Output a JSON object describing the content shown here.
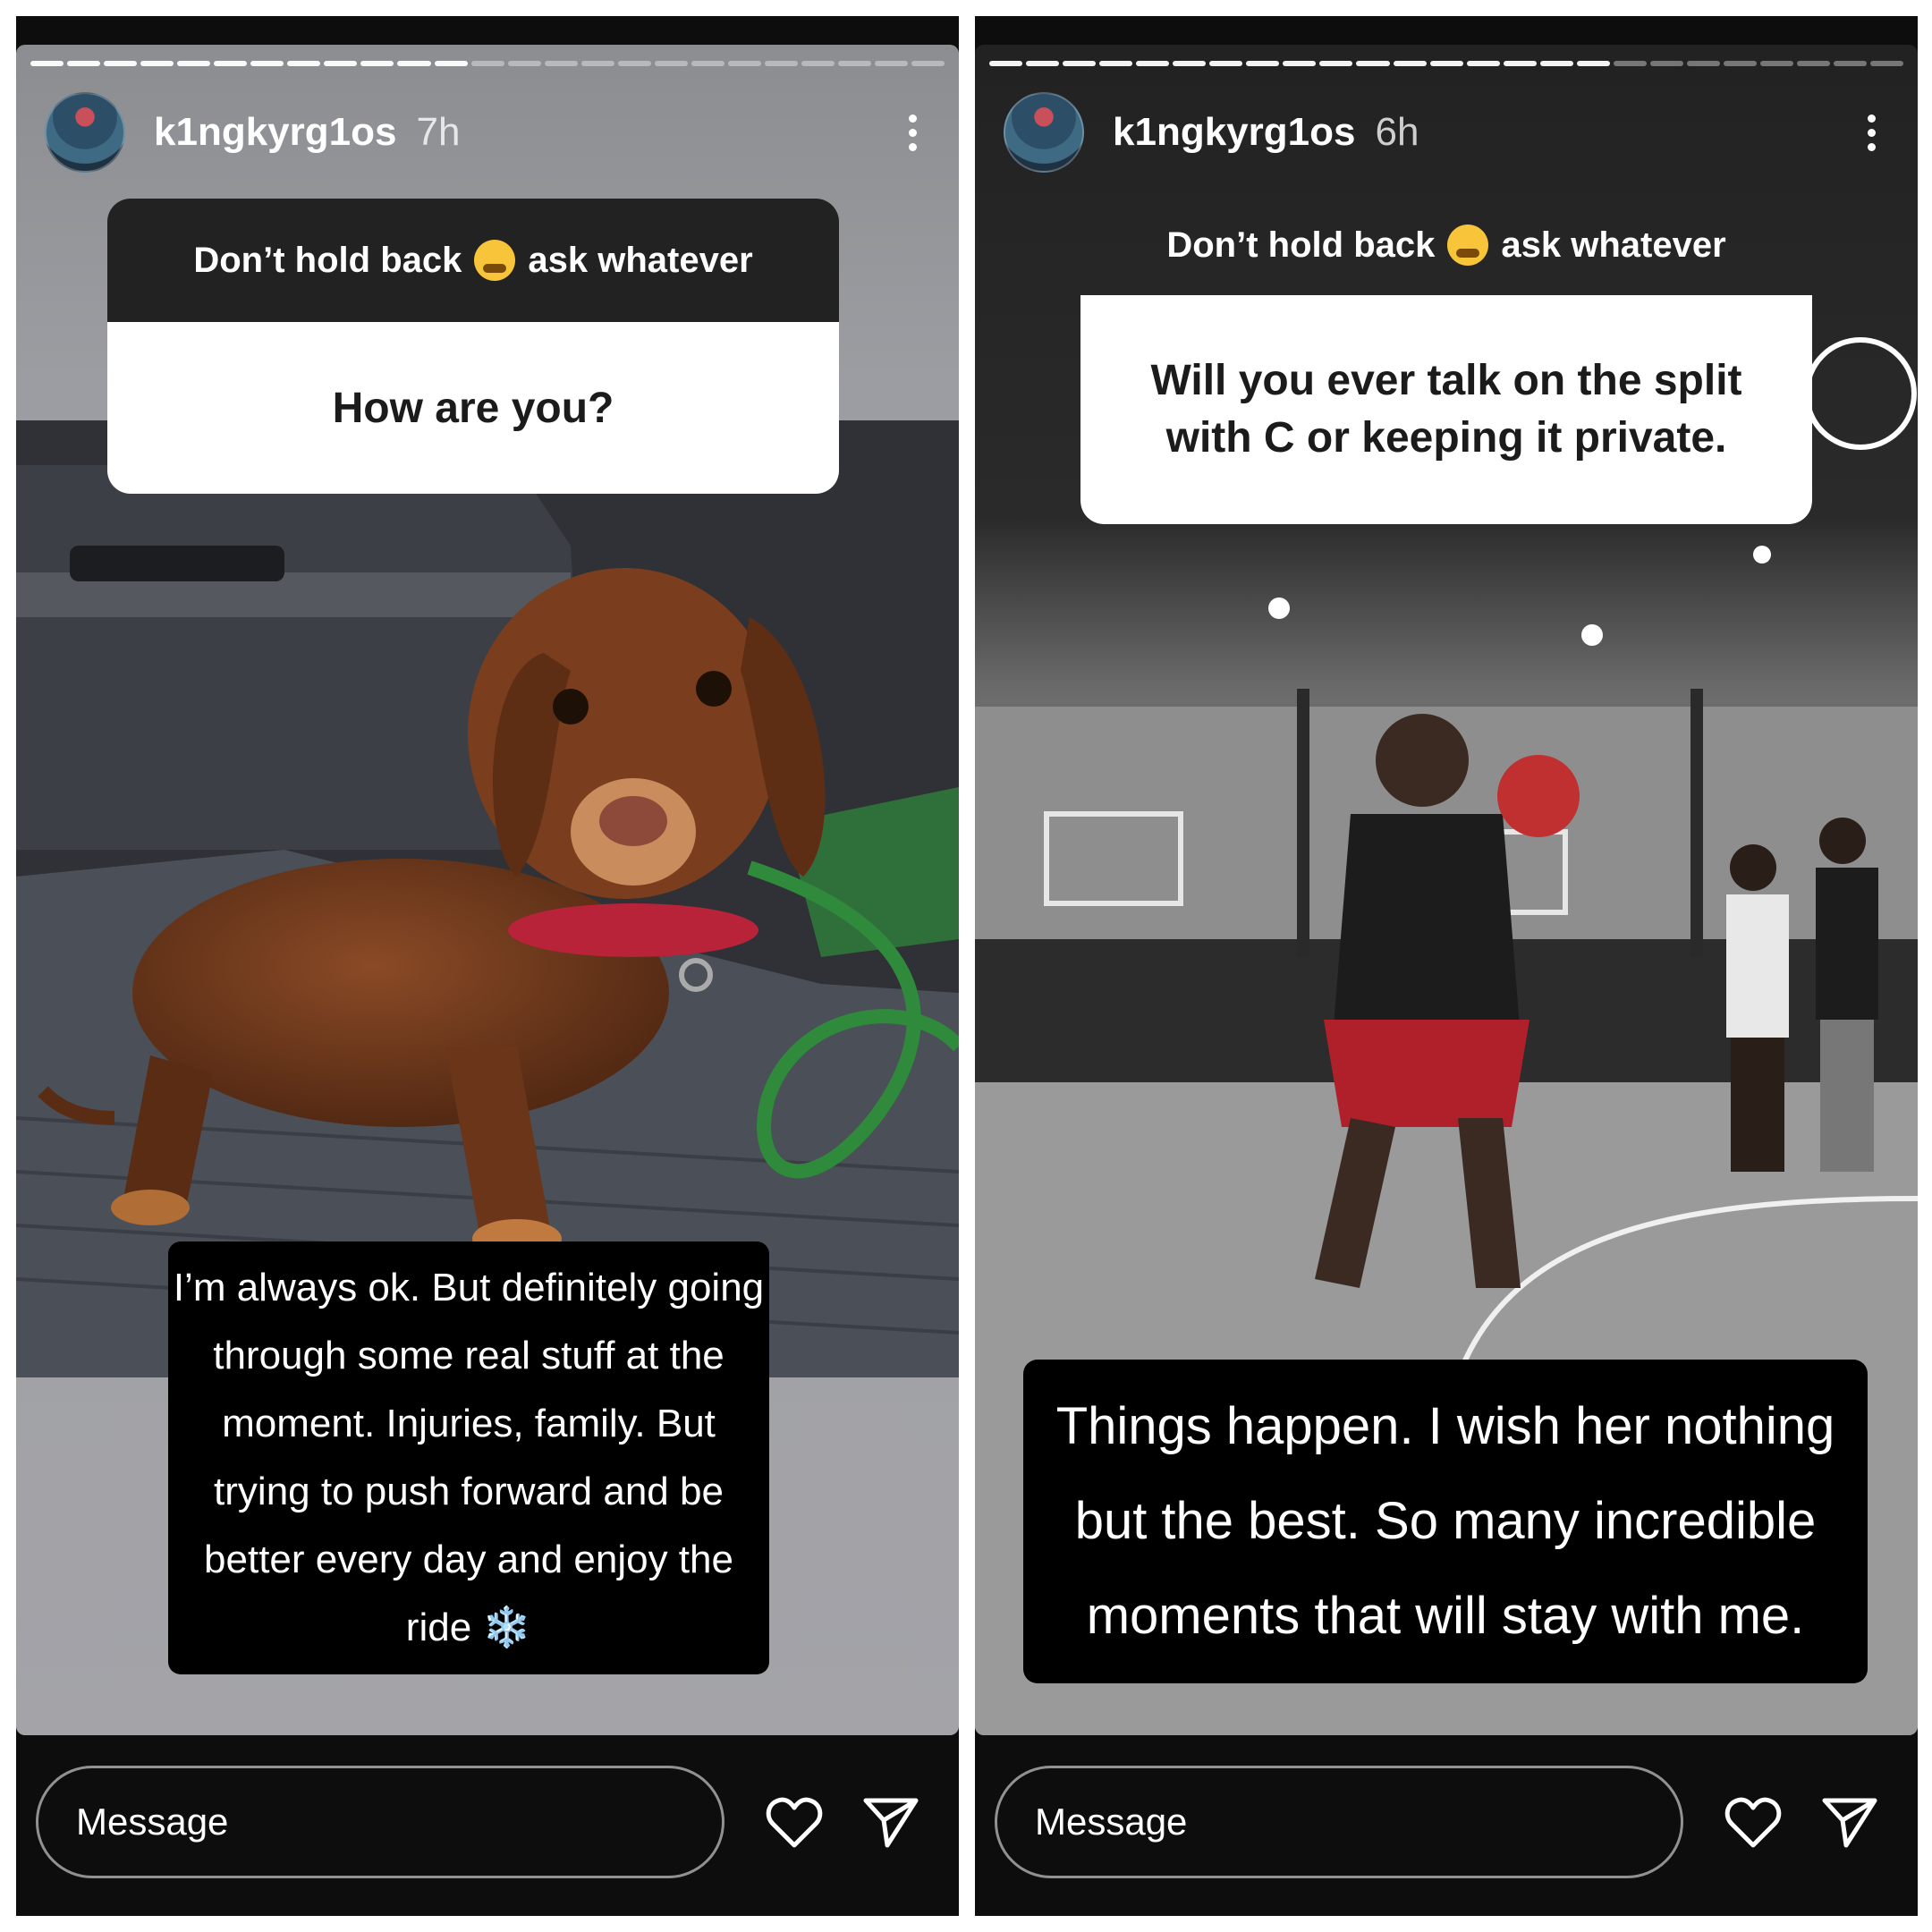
{
  "stories": [
    {
      "username": "k1ngkyrg1os",
      "time": "7h",
      "question_header_before": "Don’t hold back",
      "question_header_after": "ask whatever",
      "question": "How are you?",
      "caption_lines": [
        "I’m always ok. But definitely going",
        "through some real stuff at the",
        "moment. Injuries, family. But",
        "trying to push forward and be",
        "better every day and enjoy the",
        "ride ❄️"
      ],
      "message_placeholder": "Message",
      "progress": 0.48
    },
    {
      "username": "k1ngkyrg1os",
      "time": "6h",
      "question_header_before": "Don’t hold back",
      "question_header_after": "ask whatever",
      "question_lines": [
        "Will you ever talk on the split",
        "with C or keeping it private."
      ],
      "caption_lines": [
        "Things happen. I wish her nothing",
        "but the best. So many incredible",
        "moments that will stay with me."
      ],
      "message_placeholder": "Message",
      "progress": 0.67
    }
  ],
  "icons": [
    "avatar",
    "more-options-icon",
    "grimace-emoji-icon",
    "snowflake-emoji-icon",
    "heart-icon",
    "send-icon"
  ],
  "colors": {
    "header_bg": "#222222",
    "question_bg": "#ffffff",
    "caption_bg": "#000000",
    "story_bg": "#0d0d0d"
  }
}
